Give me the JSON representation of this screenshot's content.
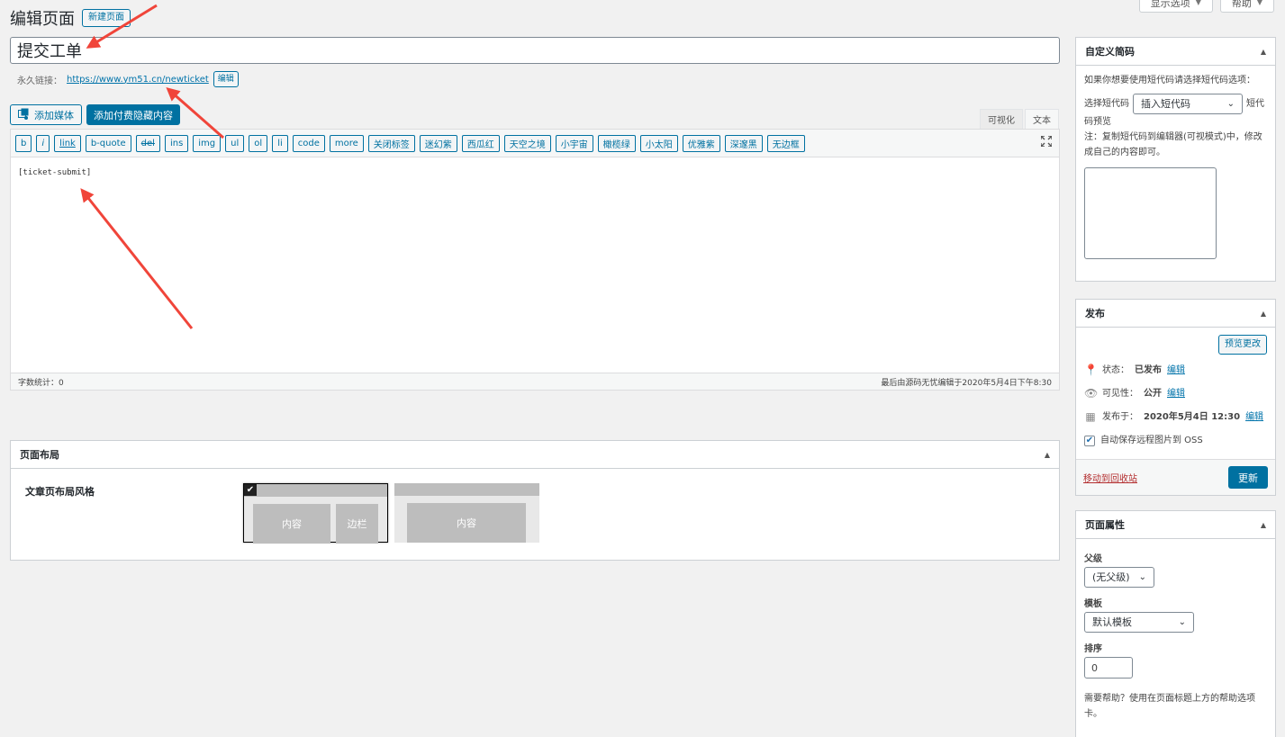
{
  "screen_meta": {
    "options": "显示选项",
    "help": "帮助"
  },
  "header": {
    "title": "编辑页面",
    "new_page": "新建页面"
  },
  "post": {
    "title": "提交工单"
  },
  "permalink": {
    "label": "永久链接：",
    "url": "https://www.ym51.cn/newticket",
    "edit": "编辑"
  },
  "media": {
    "add_media": "添加媒体",
    "add_paid": "添加付费隐藏内容"
  },
  "modes": {
    "visual": "可视化",
    "text": "文本"
  },
  "toolbar": [
    "b",
    "i",
    "link",
    "b-quote",
    "del",
    "ins",
    "img",
    "ul",
    "ol",
    "li",
    "code",
    "more",
    "关闭标签",
    "迷幻紫",
    "西瓜红",
    "天空之境",
    "小宇宙",
    "橄榄绿",
    "小太阳",
    "优雅紫",
    "深邃黑",
    "无边框"
  ],
  "editor": {
    "content": "[ticket-submit]",
    "word_count": "字数统计：0",
    "last_edit": "最后由源码无忧编辑于2020年5月4日下午8:30"
  },
  "layout": {
    "title": "页面布局",
    "label": "文章页布局风格",
    "opt1_content": "内容",
    "opt1_sidebar": "边栏",
    "opt2_content": "内容"
  },
  "shortcode": {
    "title": "自定义简码",
    "intro": "如果你想要使用短代码请选择短代码选项：",
    "select_label": "选择短代码",
    "select_value": "插入短代码",
    "preview_label_a": "短代",
    "preview_label_b": "码预览",
    "note": "注：复制短代码到编辑器(可视模式)中，修改成自己的内容即可。"
  },
  "publish": {
    "title": "发布",
    "preview": "预览更改",
    "status_label": "状态：",
    "status_value": "已发布",
    "visibility_label": "可见性：",
    "visibility_value": "公开",
    "date_label": "发布于：",
    "date_value": "2020年5月4日 12:30",
    "edit": "编辑",
    "oss": "自动保存远程图片到 OSS",
    "trash": "移动到回收站",
    "update": "更新"
  },
  "attributes": {
    "title": "页面属性",
    "parent_label": "父级",
    "parent_value": "(无父级)",
    "template_label": "模板",
    "template_value": "默认模板",
    "order_label": "排序",
    "order_value": "0",
    "help": "需要帮助？使用在页面标题上方的帮助选项卡。"
  },
  "colors": {
    "accent": "#0071a1",
    "arrow": "#f0453a"
  }
}
